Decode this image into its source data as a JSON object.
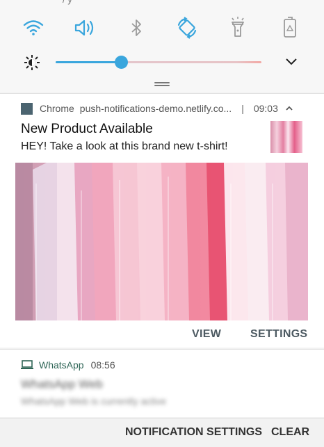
{
  "quick_settings": {
    "status_partial": "/ y",
    "toggles": [
      {
        "name": "wifi-icon",
        "active": true
      },
      {
        "name": "sound-icon",
        "active": true
      },
      {
        "name": "bluetooth-icon",
        "active": false
      },
      {
        "name": "auto-rotate-icon",
        "active": true
      },
      {
        "name": "flashlight-icon",
        "active": false
      },
      {
        "name": "battery-saver-icon",
        "active": false
      }
    ],
    "brightness_level": 0.32,
    "accent_color": "#3aa6dd"
  },
  "chrome_notification": {
    "app_name": "Chrome",
    "host": "push-notifications-demo.netlify.co...",
    "separator": "|",
    "time": "09:03",
    "title": "New Product Available",
    "text": "HEY! Take a look at this brand new t-shirt!",
    "actions": {
      "view": "VIEW",
      "settings": "SETTINGS"
    }
  },
  "whatsapp_notification": {
    "app_name": "WhatsApp",
    "time": "08:56",
    "title": "WhatsApp Web",
    "text": "WhatsApp Web is currently active"
  },
  "bottom_bar": {
    "notification_settings": "NOTIFICATION SETTINGS",
    "clear": "CLEAR"
  }
}
